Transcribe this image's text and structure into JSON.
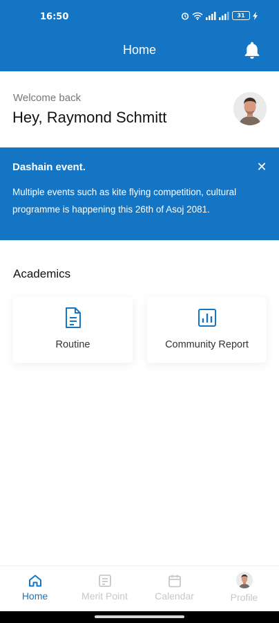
{
  "status_bar": {
    "time": "16:50",
    "battery": "31"
  },
  "app_bar": {
    "title": "Home",
    "notification_icon": "bell-icon"
  },
  "welcome": {
    "greeting": "Welcome back",
    "name": "Hey, Raymond Schmitt"
  },
  "announcement": {
    "title": "Dashain event.",
    "body": "Multiple events such as kite flying competition, cultural programme is happening this 26th of Asoj 2081.",
    "close_icon": "close-icon"
  },
  "academics": {
    "title": "Academics",
    "cards": [
      {
        "label": "Routine",
        "icon": "document-icon"
      },
      {
        "label": "Community Report",
        "icon": "bar-chart-icon"
      }
    ]
  },
  "bottom_nav": {
    "items": [
      {
        "label": "Home",
        "icon": "home-icon",
        "active": true
      },
      {
        "label": "Merit Point",
        "icon": "receipt-icon",
        "active": false
      },
      {
        "label": "Calendar",
        "icon": "calendar-icon",
        "active": false
      },
      {
        "label": "Profile",
        "icon": "avatar",
        "active": false
      }
    ]
  },
  "colors": {
    "primary": "#1375c4",
    "inactive": "#c7c7c7",
    "text_dark": "#111111",
    "text_muted": "#777777"
  }
}
